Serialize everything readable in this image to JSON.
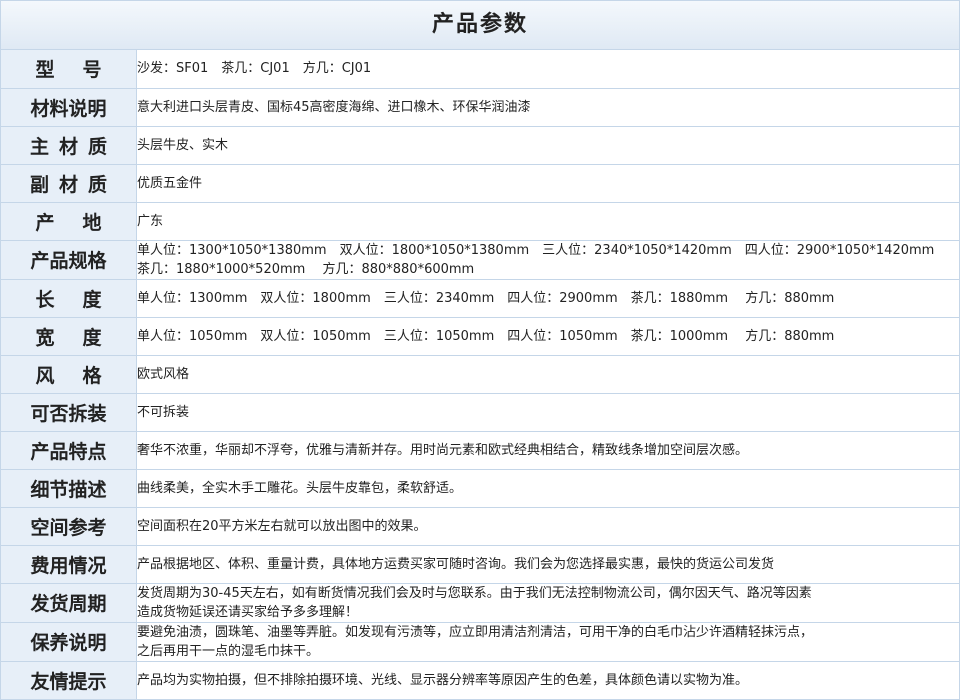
{
  "title": "产品参数",
  "rows": [
    {
      "label": "型　号",
      "value": "沙发：SF01　茶几：CJ01　方几：CJ01"
    },
    {
      "label": "材料说明",
      "value": "意大利进口头层青皮、国标45高密度海绵、进口橡木、环保华润油漆"
    },
    {
      "label": "主材质",
      "value": "头层牛皮、实木"
    },
    {
      "label": "副材质",
      "value": "优质五金件"
    },
    {
      "label": "产　地",
      "value": "广东"
    },
    {
      "label": "产品规格",
      "value": "单人位：1300*1050*1380mm　双人位：1800*1050*1380mm　三人位：2340*1050*1420mm　四人位：2900*1050*1420mm\n茶几：1880*1000*520mm　 方几：880*880*600mm"
    },
    {
      "label": "长　度",
      "value": "单人位：1300mm　双人位：1800mm　三人位：2340mm　四人位：2900mm　茶几：1880mm　 方几：880mm"
    },
    {
      "label": "宽　度",
      "value": "单人位：1050mm　双人位：1050mm　三人位：1050mm　四人位：1050mm　茶几：1000mm　 方几：880mm"
    },
    {
      "label": "风　格",
      "value": "欧式风格"
    },
    {
      "label": "可否拆装",
      "value": "不可拆装"
    },
    {
      "label": "产品特点",
      "value": "奢华不浓重，华丽却不浮夸，优雅与清新并存。用时尚元素和欧式经典相结合，精致线条增加空间层次感。"
    },
    {
      "label": "细节描述",
      "value": "曲线柔美，全实木手工雕花。头层牛皮靠包，柔软舒适。"
    },
    {
      "label": "空间参考",
      "value": "空间面积在20平方米左右就可以放出图中的效果。"
    },
    {
      "label": "费用情况",
      "value": "产品根据地区、体积、重量计费，具体地方运费买家可随时咨询。我们会为您选择最实惠，最快的货运公司发货"
    },
    {
      "label": "发货周期",
      "value": "发货周期为30-45天左右，如有断货情况我们会及时与您联系。由于我们无法控制物流公司，偶尔因天气、路况等因素\n造成货物延误还请买家给予多多理解！"
    },
    {
      "label": "保养说明",
      "value": "要避免油渍，圆珠笔、油墨等弄脏。如发现有污渍等，应立即用清洁剂清洁，可用干净的白毛巾沾少许酒精轻抹污点，\n之后再用干一点的湿毛巾抹干。"
    },
    {
      "label": "友情提示",
      "value": "产品均为实物拍摄，但不排除拍摄环境、光线、显示器分辨率等原因产生的色差，具体颜色请以实物为准。"
    }
  ]
}
